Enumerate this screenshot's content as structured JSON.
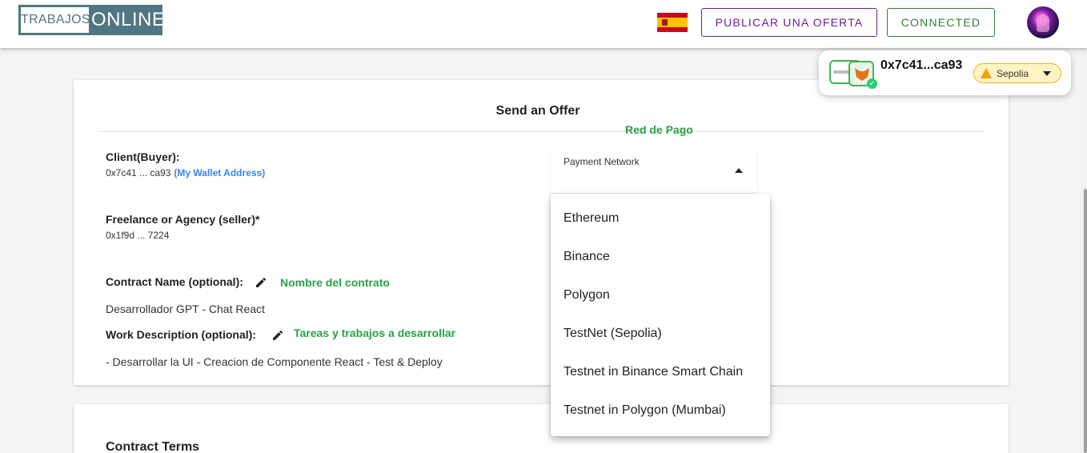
{
  "header": {
    "logo_left": "TRABAJOS",
    "logo_right": "ONLINE",
    "publish_label": "PUBLICAR UNA OFERTA",
    "connected_label": "CONNECTED",
    "flag_icon": "spain-flag-icon"
  },
  "wallet": {
    "address": "0x7c41...ca93",
    "network": "Sepolia",
    "colors": {
      "network_bg": "#fff3c4",
      "ok": "#2ecc71"
    }
  },
  "form": {
    "title": "Send an Offer",
    "payment_hint": "Red de Pago",
    "client_label": "Client(Buyer):",
    "client_value": "0x7c41 ... ca93",
    "client_hint": "(My Wallet Address)",
    "seller_label": "Freelance or Agency (seller)*",
    "seller_value": "0x1f9d ... 7224",
    "contract_name_label": "Contract Name (optional):",
    "contract_name_hint": "Nombre del contrato",
    "contract_name_value": "Desarrollador GPT - Chat React",
    "work_label": "Work Description (optional):",
    "work_hint": "Tareas y trabajos a desarrollar",
    "work_value": "- Desarrollar la UI - Creacion de Componente React - Test & Deploy",
    "select_label": "Payment Network"
  },
  "menu": {
    "options": [
      "Ethereum",
      "Binance",
      "Polygon",
      "TestNet (Sepolia)",
      "Testnet in Binance Smart Chain",
      "Testnet in Polygon (Mumbai)"
    ]
  },
  "terms": {
    "title": "Contract Terms"
  },
  "theme": {
    "purple": "#6a1b9a",
    "green": "#2e7d32",
    "hint_green": "#2aa043",
    "link_blue": "#3b82f6",
    "logo_teal": "#4f7682"
  }
}
